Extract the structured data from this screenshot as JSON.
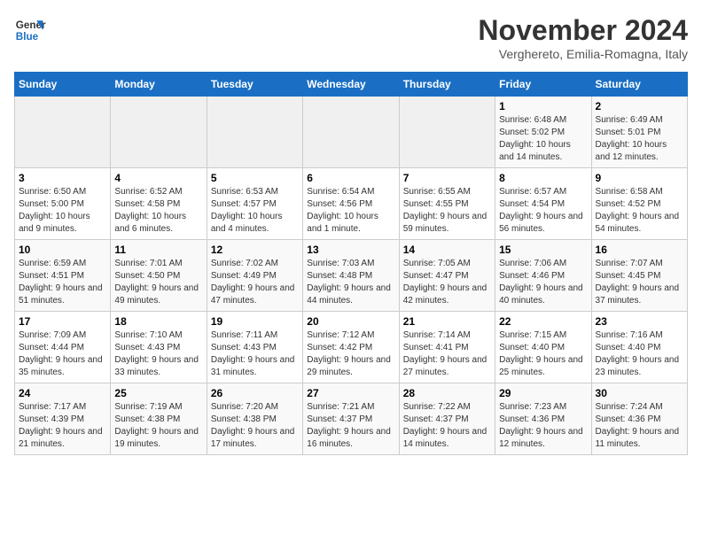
{
  "logo": {
    "line1": "General",
    "line2": "Blue"
  },
  "calendar": {
    "title": "November 2024",
    "subtitle": "Verghereto, Emilia-Romagna, Italy",
    "headers": [
      "Sunday",
      "Monday",
      "Tuesday",
      "Wednesday",
      "Thursday",
      "Friday",
      "Saturday"
    ],
    "weeks": [
      [
        {
          "day": "",
          "info": ""
        },
        {
          "day": "",
          "info": ""
        },
        {
          "day": "",
          "info": ""
        },
        {
          "day": "",
          "info": ""
        },
        {
          "day": "",
          "info": ""
        },
        {
          "day": "1",
          "info": "Sunrise: 6:48 AM\nSunset: 5:02 PM\nDaylight: 10 hours and 14 minutes."
        },
        {
          "day": "2",
          "info": "Sunrise: 6:49 AM\nSunset: 5:01 PM\nDaylight: 10 hours and 12 minutes."
        }
      ],
      [
        {
          "day": "3",
          "info": "Sunrise: 6:50 AM\nSunset: 5:00 PM\nDaylight: 10 hours and 9 minutes."
        },
        {
          "day": "4",
          "info": "Sunrise: 6:52 AM\nSunset: 4:58 PM\nDaylight: 10 hours and 6 minutes."
        },
        {
          "day": "5",
          "info": "Sunrise: 6:53 AM\nSunset: 4:57 PM\nDaylight: 10 hours and 4 minutes."
        },
        {
          "day": "6",
          "info": "Sunrise: 6:54 AM\nSunset: 4:56 PM\nDaylight: 10 hours and 1 minute."
        },
        {
          "day": "7",
          "info": "Sunrise: 6:55 AM\nSunset: 4:55 PM\nDaylight: 9 hours and 59 minutes."
        },
        {
          "day": "8",
          "info": "Sunrise: 6:57 AM\nSunset: 4:54 PM\nDaylight: 9 hours and 56 minutes."
        },
        {
          "day": "9",
          "info": "Sunrise: 6:58 AM\nSunset: 4:52 PM\nDaylight: 9 hours and 54 minutes."
        }
      ],
      [
        {
          "day": "10",
          "info": "Sunrise: 6:59 AM\nSunset: 4:51 PM\nDaylight: 9 hours and 51 minutes."
        },
        {
          "day": "11",
          "info": "Sunrise: 7:01 AM\nSunset: 4:50 PM\nDaylight: 9 hours and 49 minutes."
        },
        {
          "day": "12",
          "info": "Sunrise: 7:02 AM\nSunset: 4:49 PM\nDaylight: 9 hours and 47 minutes."
        },
        {
          "day": "13",
          "info": "Sunrise: 7:03 AM\nSunset: 4:48 PM\nDaylight: 9 hours and 44 minutes."
        },
        {
          "day": "14",
          "info": "Sunrise: 7:05 AM\nSunset: 4:47 PM\nDaylight: 9 hours and 42 minutes."
        },
        {
          "day": "15",
          "info": "Sunrise: 7:06 AM\nSunset: 4:46 PM\nDaylight: 9 hours and 40 minutes."
        },
        {
          "day": "16",
          "info": "Sunrise: 7:07 AM\nSunset: 4:45 PM\nDaylight: 9 hours and 37 minutes."
        }
      ],
      [
        {
          "day": "17",
          "info": "Sunrise: 7:09 AM\nSunset: 4:44 PM\nDaylight: 9 hours and 35 minutes."
        },
        {
          "day": "18",
          "info": "Sunrise: 7:10 AM\nSunset: 4:43 PM\nDaylight: 9 hours and 33 minutes."
        },
        {
          "day": "19",
          "info": "Sunrise: 7:11 AM\nSunset: 4:43 PM\nDaylight: 9 hours and 31 minutes."
        },
        {
          "day": "20",
          "info": "Sunrise: 7:12 AM\nSunset: 4:42 PM\nDaylight: 9 hours and 29 minutes."
        },
        {
          "day": "21",
          "info": "Sunrise: 7:14 AM\nSunset: 4:41 PM\nDaylight: 9 hours and 27 minutes."
        },
        {
          "day": "22",
          "info": "Sunrise: 7:15 AM\nSunset: 4:40 PM\nDaylight: 9 hours and 25 minutes."
        },
        {
          "day": "23",
          "info": "Sunrise: 7:16 AM\nSunset: 4:40 PM\nDaylight: 9 hours and 23 minutes."
        }
      ],
      [
        {
          "day": "24",
          "info": "Sunrise: 7:17 AM\nSunset: 4:39 PM\nDaylight: 9 hours and 21 minutes."
        },
        {
          "day": "25",
          "info": "Sunrise: 7:19 AM\nSunset: 4:38 PM\nDaylight: 9 hours and 19 minutes."
        },
        {
          "day": "26",
          "info": "Sunrise: 7:20 AM\nSunset: 4:38 PM\nDaylight: 9 hours and 17 minutes."
        },
        {
          "day": "27",
          "info": "Sunrise: 7:21 AM\nSunset: 4:37 PM\nDaylight: 9 hours and 16 minutes."
        },
        {
          "day": "28",
          "info": "Sunrise: 7:22 AM\nSunset: 4:37 PM\nDaylight: 9 hours and 14 minutes."
        },
        {
          "day": "29",
          "info": "Sunrise: 7:23 AM\nSunset: 4:36 PM\nDaylight: 9 hours and 12 minutes."
        },
        {
          "day": "30",
          "info": "Sunrise: 7:24 AM\nSunset: 4:36 PM\nDaylight: 9 hours and 11 minutes."
        }
      ]
    ]
  }
}
